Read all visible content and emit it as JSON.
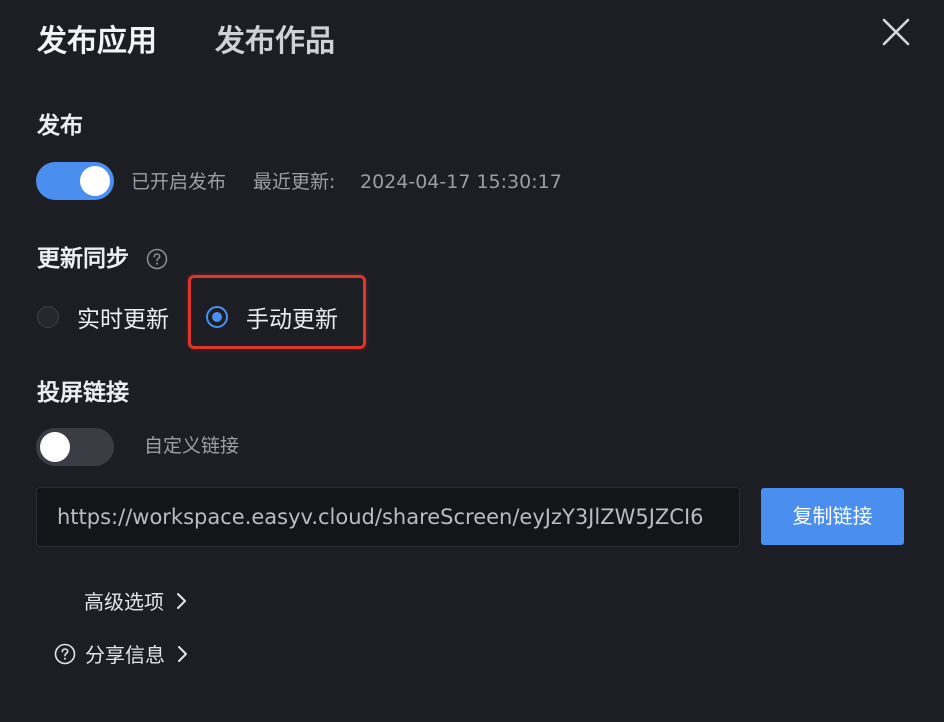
{
  "tabs": {
    "publish_app": "发布应用",
    "publish_work": "发布作品"
  },
  "publish": {
    "title": "发布",
    "toggle_state": "on",
    "status_text": "已开启发布",
    "last_update_label": "最近更新:",
    "last_update_time": "2024-04-17 15:30:17"
  },
  "sync": {
    "title": "更新同步",
    "options": [
      {
        "label": "实时更新",
        "checked": false
      },
      {
        "label": "手动更新",
        "checked": true
      }
    ]
  },
  "screen_link": {
    "title": "投屏链接",
    "toggle_state": "off",
    "custom_link_label": "自定义链接",
    "url_value": "https://workspace.easyv.cloud/shareScreen/eyJzY3JlZW5JZCI6",
    "copy_button": "复制链接"
  },
  "links": {
    "advanced": "高级选项",
    "share_info": "分享信息"
  },
  "colors": {
    "accent": "#4a8fef",
    "background": "#1c1e23",
    "highlight": "#e0352b"
  }
}
